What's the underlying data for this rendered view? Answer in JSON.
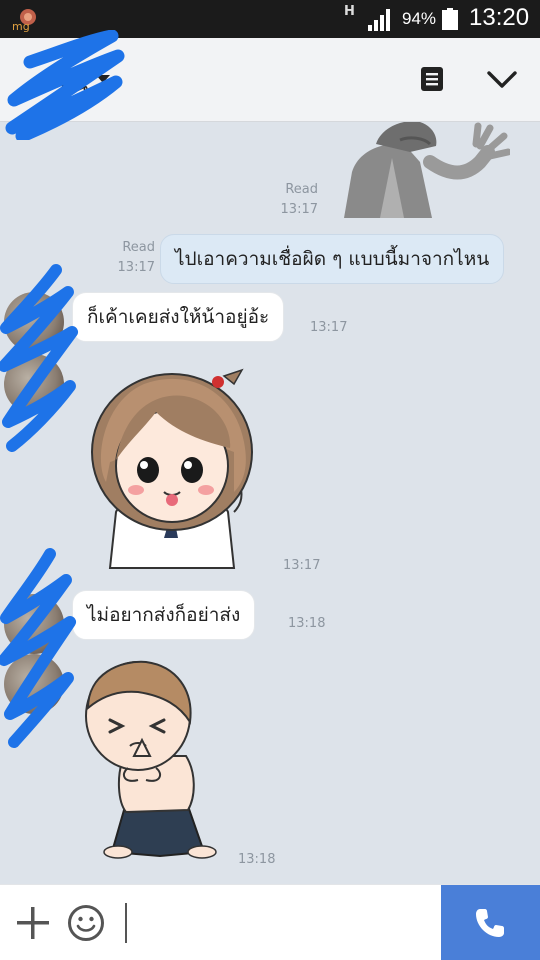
{
  "status_bar": {
    "network": "H",
    "battery_percent": "94%",
    "time": "13:20",
    "icons": [
      "app-notification-icon",
      "signal-icon",
      "battery-icon"
    ]
  },
  "header": {
    "contact_name": "นั้น",
    "icons": [
      "dropdown-caret-icon",
      "menu-icon",
      "chevron-down-icon"
    ]
  },
  "messages": [
    {
      "type": "sticker",
      "sender": "me",
      "read": "Read",
      "time": "13:17",
      "sticker": "man-covering-face"
    },
    {
      "type": "text",
      "sender": "me",
      "read": "Read",
      "time": "13:17",
      "text": "ไปเอาความเชื่อผิด ๆ แบบนี้มาจากไหน"
    },
    {
      "type": "text",
      "sender": "them",
      "time": "13:17",
      "text": "ก็เค้าเคยส่งให้น้าอยู่อ้ะ"
    },
    {
      "type": "sticker",
      "sender": "them",
      "time": "13:17",
      "sticker": "girl-sticking-tongue-out"
    },
    {
      "type": "text",
      "sender": "them",
      "time": "13:18",
      "text": "ไม่อยากส่งก็อย่าส่ง"
    },
    {
      "type": "sticker",
      "sender": "them",
      "time": "13:18",
      "sticker": "boy-kneeling-begging"
    }
  ],
  "input_bar": {
    "placeholder": "",
    "icons": [
      "plus-icon",
      "emoji-icon",
      "phone-icon"
    ]
  },
  "colors": {
    "chat_background": "#dde3ea",
    "my_bubble": "#dce9f5",
    "their_bubble": "#ffffff",
    "call_button": "#4a7fd8",
    "scribble": "#1e73e8"
  }
}
